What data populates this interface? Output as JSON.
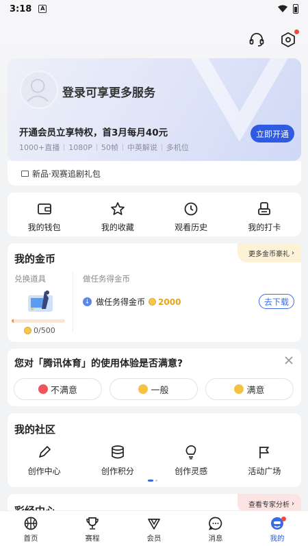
{
  "status_bar": {
    "time": "3:18",
    "notification_letter": "A"
  },
  "member_card": {
    "login_title": "登录可享更多服务",
    "promo": "开通会员立享特权，首3月每月40元",
    "features": [
      "1000+直播",
      "1080P",
      "50帧",
      "中英解说",
      "多机位"
    ],
    "open_button": "立即开通"
  },
  "gift_bar": {
    "label": "新品·观赛追剧礼包"
  },
  "quick_links": [
    {
      "label": "我的钱包",
      "icon": "wallet-icon"
    },
    {
      "label": "我的收藏",
      "icon": "star-icon"
    },
    {
      "label": "观看历史",
      "icon": "clock-icon"
    },
    {
      "label": "我的打卡",
      "icon": "checkin-icon"
    }
  ],
  "coins": {
    "title": "我的金币",
    "more_label": "更多金币豪礼",
    "exchange_label": "兑换道具",
    "progress": 0.04,
    "coin_count": "0/500",
    "task_label": "做任务得金币",
    "task_text": "做任务得金币",
    "task_amount": "2000",
    "download_button": "去下载"
  },
  "survey": {
    "question": "您对「腾讯体育」的使用体验是否满意?",
    "options": [
      {
        "label": "不满意",
        "color": "#f0555b"
      },
      {
        "label": "一般",
        "color": "#f5c343"
      },
      {
        "label": "满意",
        "color": "#f5c343"
      }
    ]
  },
  "community": {
    "title": "我的社区",
    "items": [
      {
        "label": "创作中心",
        "icon": "pen-icon"
      },
      {
        "label": "创作积分",
        "icon": "coins-stack-icon"
      },
      {
        "label": "创作灵感",
        "icon": "bulb-icon"
      },
      {
        "label": "活动广场",
        "icon": "flag-icon"
      }
    ]
  },
  "lottery": {
    "title": "彩经中心",
    "more_label": "查看专家分析"
  },
  "tabbar": [
    {
      "label": "首页",
      "icon": "basketball-icon"
    },
    {
      "label": "赛程",
      "icon": "trophy-icon"
    },
    {
      "label": "会员",
      "icon": "diamond-icon"
    },
    {
      "label": "消息",
      "icon": "message-icon"
    },
    {
      "label": "我的",
      "icon": "profile-icon",
      "active": true
    }
  ],
  "colors": {
    "accent": "#2f5be3",
    "coin": "#f7c64a",
    "badge": "#f04a3c"
  }
}
